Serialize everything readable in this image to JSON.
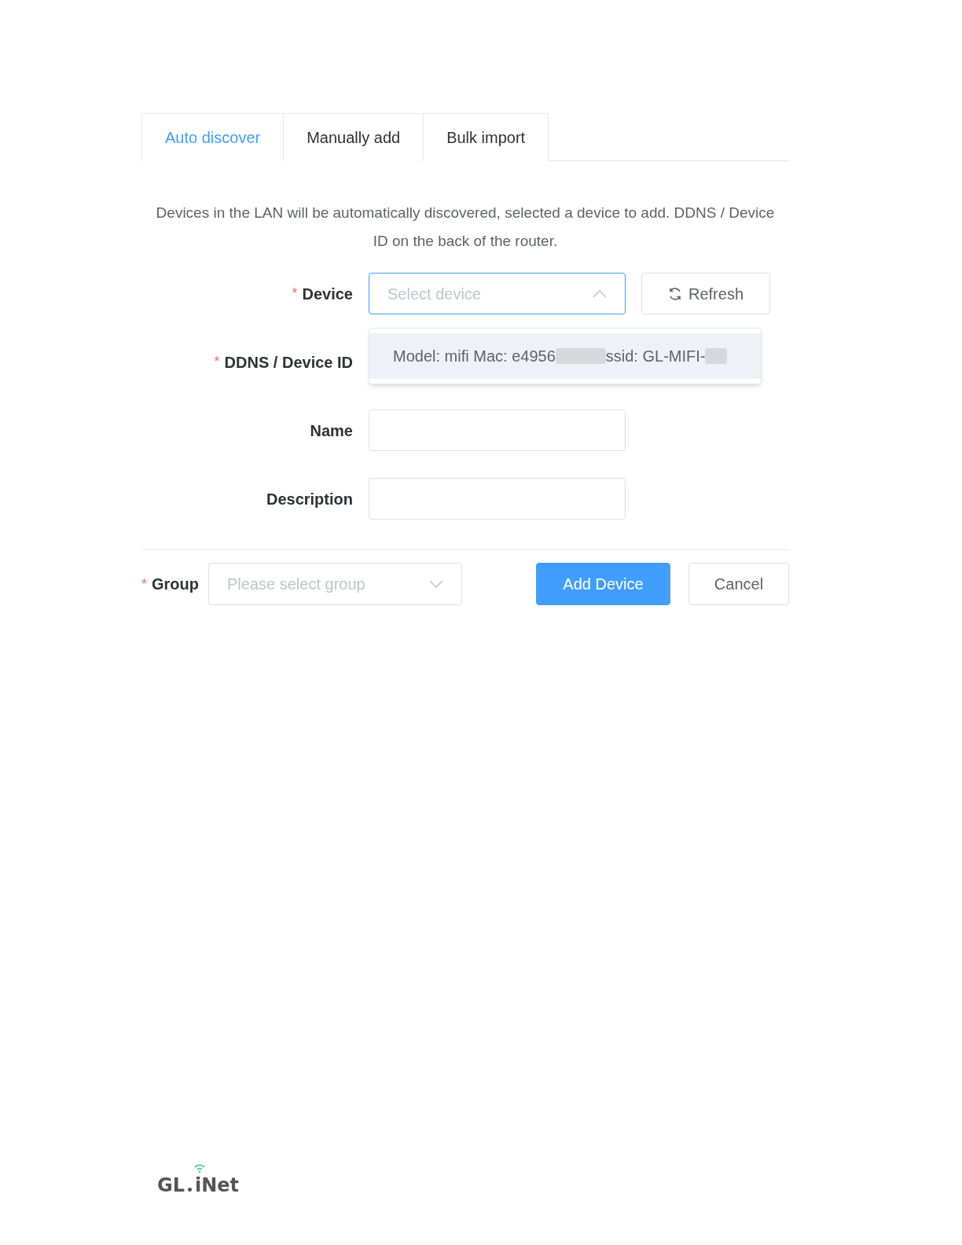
{
  "tabs": [
    {
      "label": "Auto discover",
      "selected": true
    },
    {
      "label": "Manually add",
      "selected": false
    },
    {
      "label": "Bulk import",
      "selected": false
    }
  ],
  "intro": "Devices in the LAN will be automatically discovered, selected a device to add. DDNS / Device ID on the back of the router.",
  "fields": [
    {
      "label": "Device",
      "required_mark": "*",
      "kind": "select",
      "placeholder": "Select device",
      "open": true
    },
    {
      "label": "DDNS / Device ID",
      "required_mark": "*",
      "kind": "hidden"
    },
    {
      "label": "Name",
      "kind": "input"
    },
    {
      "label": "Description",
      "kind": "input"
    }
  ],
  "refresh_button": "Refresh",
  "dropdown_options": [
    {
      "parts": [
        "Model: mifi Mac: e4956",
        "ssid: GL-MIFI-"
      ],
      "redacted": true,
      "highlighted": true
    }
  ],
  "group": {
    "label": "Group",
    "required_mark": "*",
    "placeholder": "Please select group"
  },
  "buttons": [
    {
      "label": "Add Device",
      "kind": "primary"
    },
    {
      "label": "Cancel",
      "kind": "default"
    }
  ],
  "logo": {
    "text_left": "GL",
    "text_right": "iNet"
  }
}
